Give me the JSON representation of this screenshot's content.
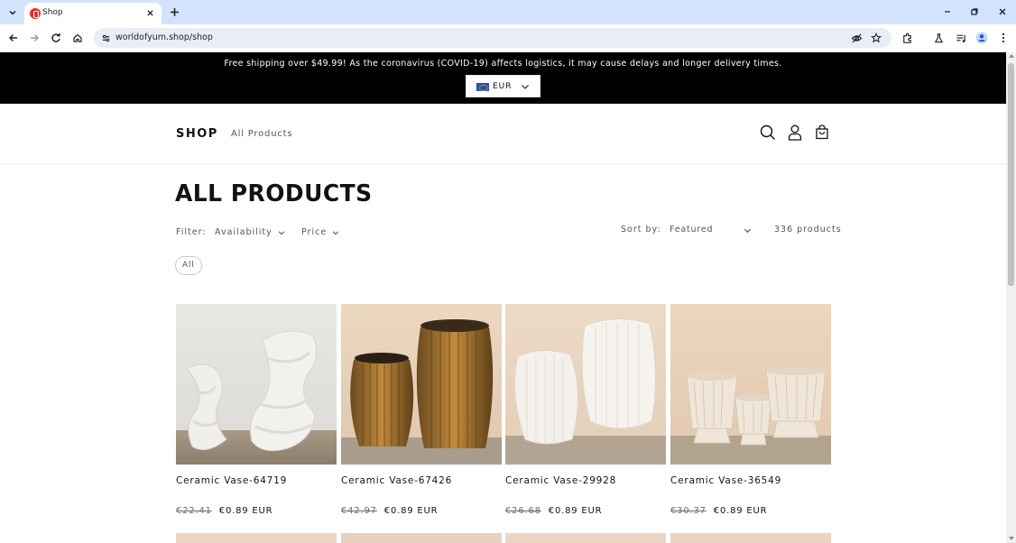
{
  "browser": {
    "tab_title": "Shop",
    "url": "worldofyum.shop/shop"
  },
  "announcement": {
    "text": "Free shipping over $49.99! As the coronavirus (COVID-19) affects logistics, it may cause delays and longer delivery times.",
    "currency": "EUR"
  },
  "header": {
    "logo": "SHOP",
    "nav": [
      "All Products"
    ]
  },
  "collection": {
    "title": "ALL PRODUCTS",
    "filter_label": "Filter:",
    "filters": [
      "Availability",
      "Price"
    ],
    "sort_label": "Sort by:",
    "sort_value": "Featured",
    "product_count": "336 products",
    "active_pill": "All"
  },
  "products": [
    {
      "title": "Ceramic Vase-64719",
      "compare_price": "€22.41",
      "price": "€0.89 EUR"
    },
    {
      "title": "Ceramic Vase-67426",
      "compare_price": "€42.97",
      "price": "€0.89 EUR"
    },
    {
      "title": "Ceramic Vase-29928",
      "compare_price": "€26.68",
      "price": "€0.89 EUR"
    },
    {
      "title": "Ceramic Vase-36549",
      "compare_price": "€30.37",
      "price": "€0.89 EUR"
    }
  ],
  "colors": {
    "tabbar_bg": "#d3e3fd",
    "announcement_bg": "#000000",
    "accent_favicon": "#e03131"
  },
  "icons": [
    "chevron-down-icon",
    "close-icon",
    "plus-icon",
    "minimize-icon",
    "restore-icon",
    "back-icon",
    "forward-icon",
    "reload-icon",
    "home-icon",
    "site-info-icon",
    "eye-off-icon",
    "star-icon",
    "extensions-icon",
    "labs-icon",
    "media-icon",
    "profile-icon",
    "menu-icon",
    "search-icon",
    "account-icon",
    "cart-icon"
  ]
}
